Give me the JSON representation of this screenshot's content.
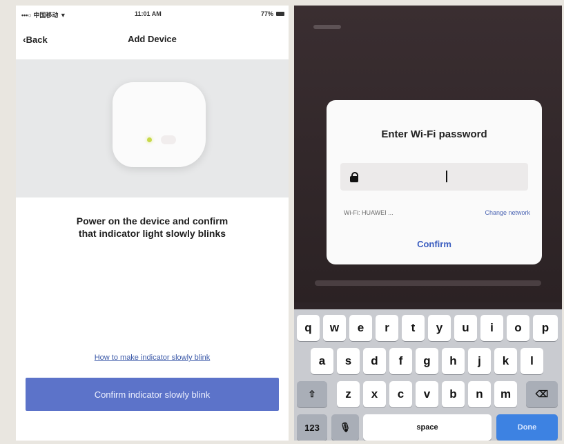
{
  "left_screen": {
    "status": {
      "carrier": "•••○ 中国移动 ▼",
      "time": "11:01 AM",
      "battery": "77%"
    },
    "nav": {
      "back_label": "Back",
      "title": "Add Device"
    },
    "instruction_line1": "Power on the device and confirm",
    "instruction_line2": "that indicator light slowly blinks",
    "help_link": "How to make indicator slowly blink",
    "confirm_button": "Confirm indicator slowly blink"
  },
  "right_screen": {
    "dialog": {
      "title": "Enter Wi-Fi password",
      "wifi_label": "Wi-Fi: HUAWEI ...",
      "change_network": "Change network",
      "confirm": "Confirm"
    },
    "keyboard": {
      "row1": [
        "q",
        "w",
        "e",
        "r",
        "t",
        "y",
        "u",
        "i",
        "o",
        "p"
      ],
      "row2": [
        "a",
        "s",
        "d",
        "f",
        "g",
        "h",
        "j",
        "k",
        "l"
      ],
      "row3": [
        "z",
        "x",
        "c",
        "v",
        "b",
        "n",
        "m"
      ],
      "shift": "⇧",
      "backspace": "⌫",
      "numbers": "123",
      "mic": "🎙",
      "space": "space",
      "done": "Done"
    }
  },
  "colors": {
    "accent_button": "#5c73c9",
    "link": "#3a58a8",
    "done_key": "#3d82e2"
  }
}
